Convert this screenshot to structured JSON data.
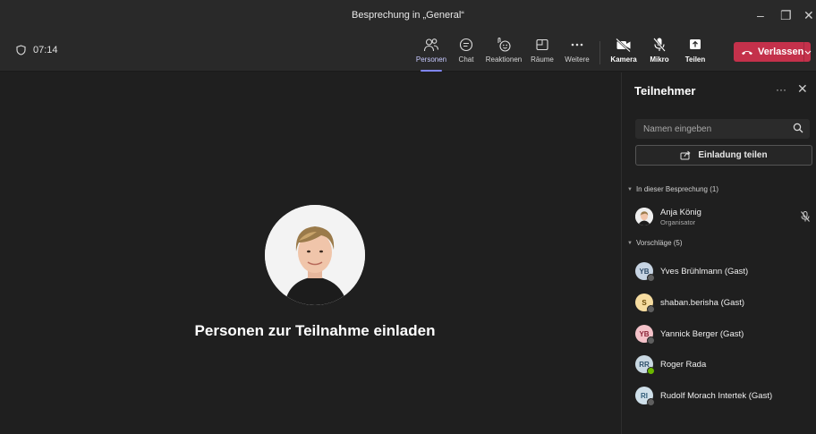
{
  "window": {
    "title": "Besprechung in „General“",
    "controls": {
      "minimize": "–",
      "restore": "❐",
      "close": "✕"
    }
  },
  "toolbar": {
    "timer": "07:14",
    "buttons": [
      {
        "label": "Personen",
        "icon": "people-icon",
        "active": true
      },
      {
        "label": "Chat",
        "icon": "chat-icon"
      },
      {
        "label": "Reaktionen",
        "icon": "reactions-icon"
      },
      {
        "label": "Räume",
        "icon": "rooms-icon"
      },
      {
        "label": "Weitere",
        "icon": "more-icon"
      },
      {
        "label": "Kamera",
        "icon": "camera-off-icon"
      },
      {
        "label": "Mikro",
        "icon": "mic-off-icon"
      },
      {
        "label": "Teilen",
        "icon": "share-screen-icon"
      }
    ],
    "leave_label": "Verlassen",
    "leave_color": "#c4314b"
  },
  "stage": {
    "invite_text": "Personen zur Teilnahme einladen"
  },
  "panel": {
    "title": "Teilnehmer",
    "more": "···",
    "close": "✕",
    "search_placeholder": "Namen eingeben",
    "share_label": "Einladung teilen",
    "section_in_meeting": "In dieser Besprechung (1)",
    "organizer": {
      "name": "Anja König",
      "role": "Organisator"
    },
    "section_suggestions": "Vorschläge (5)",
    "suggestions": [
      {
        "initials": "YB",
        "name": "Yves Brühlmann (Gast)",
        "bg": "#c7d4e3",
        "fg": "#2f4b68",
        "online": false
      },
      {
        "initials": "S",
        "name": "shaban.berisha (Gast)",
        "bg": "#f6dca0",
        "fg": "#6b4b08",
        "online": false
      },
      {
        "initials": "YB",
        "name": "Yannick Berger (Gast)",
        "bg": "#f4c2c9",
        "fg": "#8a2437",
        "online": false
      },
      {
        "initials": "RR",
        "name": "Roger Rada",
        "bg": "#c9d8e2",
        "fg": "#30506a",
        "online": true
      },
      {
        "initials": "RI",
        "name": "Rudolf Morach Intertek (Gast)",
        "bg": "#cfe0ea",
        "fg": "#2f5c78",
        "online": false
      }
    ]
  }
}
